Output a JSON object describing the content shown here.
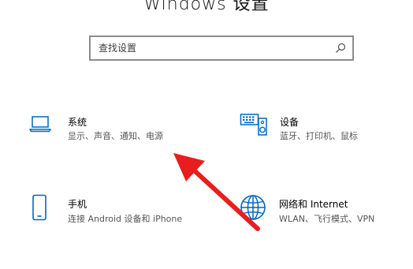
{
  "window": {
    "title": "Windows 设置"
  },
  "search": {
    "placeholder": "查找设置",
    "value": ""
  },
  "tiles": [
    {
      "name": "系统",
      "description": "显示、声音、通知、电源",
      "icon": "laptop-icon"
    },
    {
      "name": "设备",
      "description": "蓝牙、打印机、鼠标",
      "icon": "keyboard-speaker-icon"
    },
    {
      "name": "手机",
      "description": "连接 Android 设备和 iPhone",
      "icon": "phone-icon"
    },
    {
      "name": "网络和 Internet",
      "description": "WLAN、飞行模式、VPN",
      "icon": "globe-icon"
    }
  ],
  "colors": {
    "accent": "#0067c0",
    "annotation_arrow": "#e81e1e",
    "search_border": "#8c8c8c"
  }
}
